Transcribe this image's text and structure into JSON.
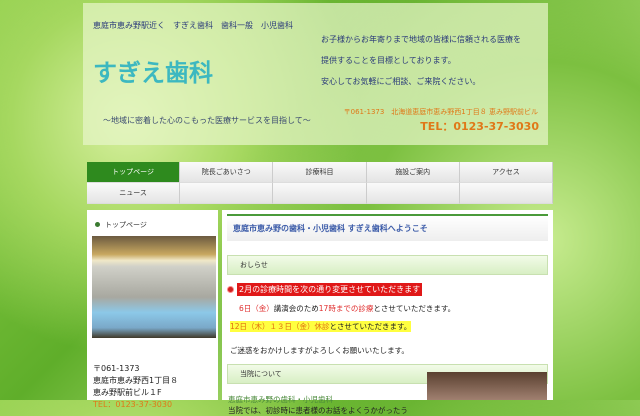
{
  "header": {
    "tagline": "恵庭市恵み野駅近く　すぎえ歯科　歯科一般　小児歯科",
    "logo": "すぎえ歯科",
    "slogan": "～地域に密着した心のこもった医療サービスを目指して～",
    "message": [
      "お子様からお年寄りまで地域の皆様に信頼される医療を",
      "提供することを目標としております。",
      "安心してお気軽にご相談、ご来院ください。"
    ],
    "address": "〒061-1373　北海道恵庭市恵み野西1丁目８ 恵み野駅前ビル",
    "tel": "TEL：0123-37-3030"
  },
  "nav": [
    "トップページ",
    "院長ごあいさつ",
    "診療科目",
    "施設ご案内",
    "アクセス",
    "ニュース",
    "",
    "",
    "",
    ""
  ],
  "sidebar": {
    "title": "トップページ",
    "address": [
      "〒061-1373",
      "恵庭市恵み野西1丁目８",
      "恵み野駅前ビル１F",
      "TEL：0123-37-3030"
    ]
  },
  "main": {
    "welcome": "恵庭市恵み野の歯科・小児歯科 すぎえ歯科へようこそ",
    "news_title": "おしらせ",
    "news_headline": "2月の診療時間を次の通り変更させていただきます",
    "news_line1": {
      "a": "6日（金）",
      "b": "講演会のため",
      "c": "17時までの診療",
      "d": "とさせていただきます。"
    },
    "news_line2": {
      "a": "12日（木）１３日（金）休診",
      "b": "とさせていただきます。"
    },
    "news_apology": "ご迷惑をおかけしますがよろしくお願いいたします。",
    "about_title": "当院について",
    "about_sub": "恵庭市恵み野の歯科・小児歯科",
    "about_text": "当院では、初診時に患者様のお話をよくうかがったう"
  }
}
